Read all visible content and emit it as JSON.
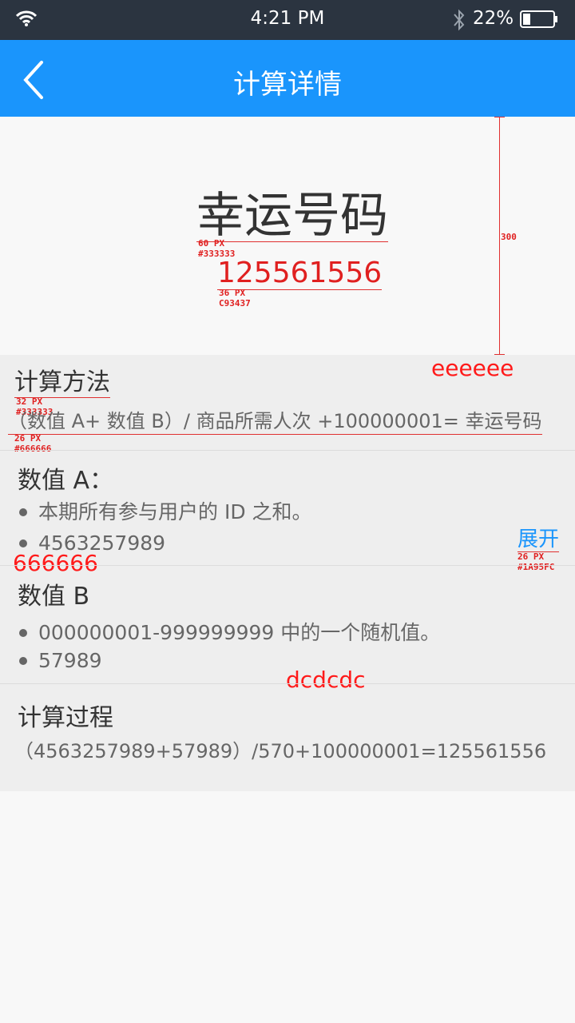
{
  "status_bar": {
    "time": "4:21 PM",
    "battery": "22%",
    "icons": [
      "wifi-icon",
      "bluetooth-icon",
      "battery-icon"
    ]
  },
  "nav": {
    "title": "计算详情",
    "back_icon": "chevron-left-icon"
  },
  "hero": {
    "title": "幸运号码",
    "title_note": [
      "60 PX",
      "#333333"
    ],
    "number": "125561556",
    "number_note": [
      "36 PX",
      "C93437"
    ],
    "height_note": "300"
  },
  "method": {
    "bg_note": "eeeeee",
    "title": "计算方法",
    "title_note": [
      "32 PX",
      "#333333"
    ],
    "formula": "（数值 A+ 数值 B）/ 商品所需人次 +100000001= 幸运号码",
    "formula_note": [
      "26 PX",
      "#666666"
    ]
  },
  "value_a": {
    "title": "数值 A：",
    "items": [
      "本期所有参与用户的 ID 之和。",
      "4563257989"
    ],
    "color_note": "666666",
    "expand_label": "展开",
    "expand_note": [
      "26 PX",
      "#1A95FC"
    ]
  },
  "value_b": {
    "title": "数值 B",
    "items": [
      "000000001-999999999 中的一个随机值。",
      "57989"
    ],
    "divider_note": "dcdcdc"
  },
  "process": {
    "title": "计算过程",
    "formula": "（4563257989+57989）/570+100000001=125561556"
  },
  "colors": {
    "accent": "#1a95fc",
    "status_bar": "#2b3440",
    "content_bg": "#eeeeee",
    "divider": "#dcdcdc",
    "annotation": "#e02020"
  }
}
